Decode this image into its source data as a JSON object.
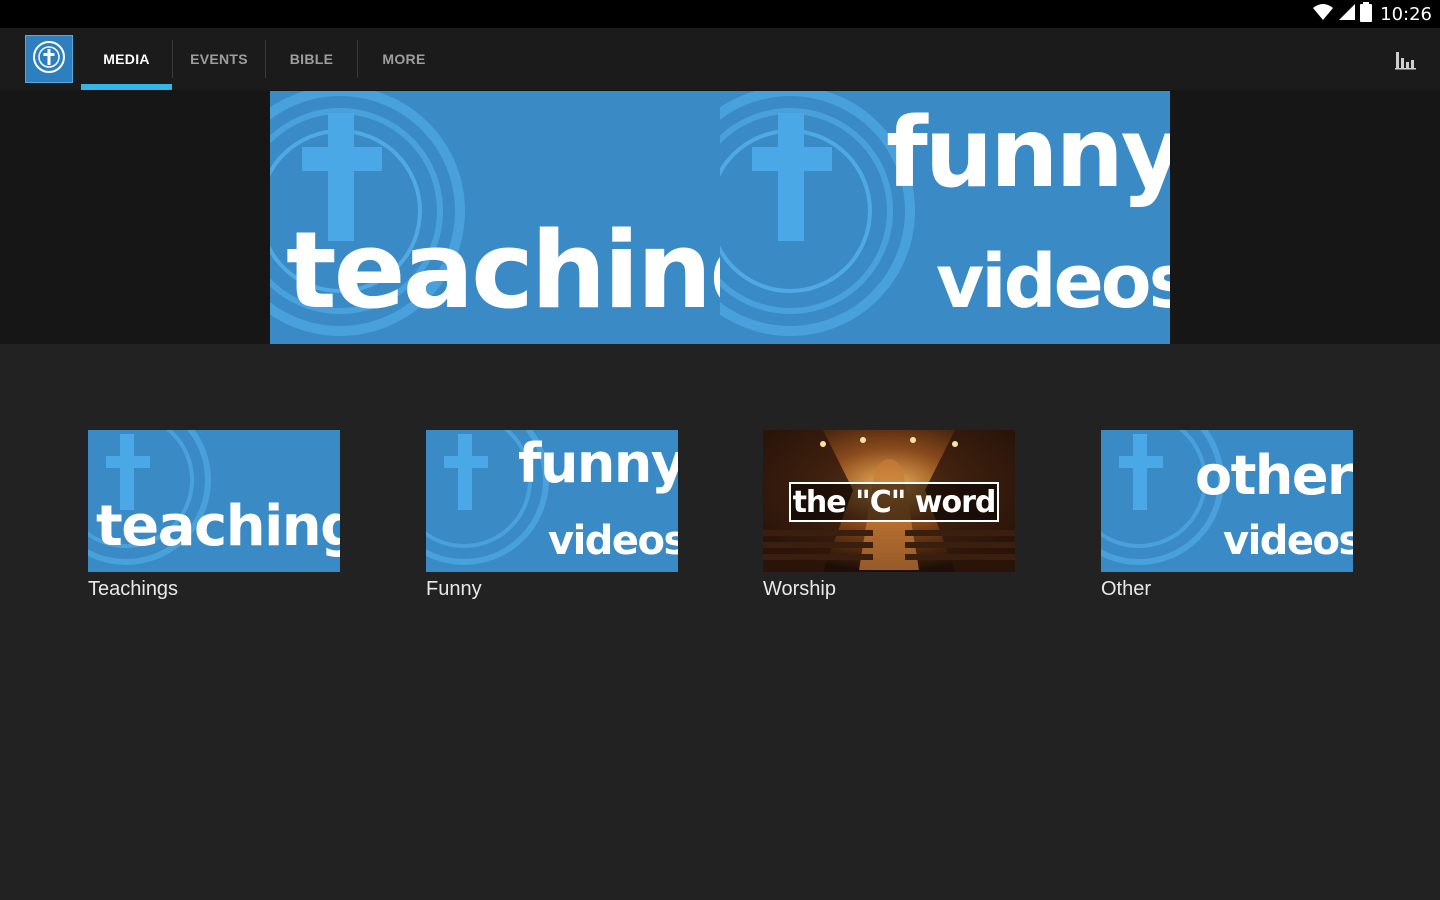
{
  "status_bar": {
    "time": "10:26",
    "icons": [
      "wifi-icon",
      "cellular-signal-icon",
      "battery-icon"
    ]
  },
  "action_bar": {
    "tabs": [
      {
        "label": "MEDIA",
        "active": true
      },
      {
        "label": "EVENTS",
        "active": false
      },
      {
        "label": "BIBLE",
        "active": false
      },
      {
        "label": "MORE",
        "active": false
      }
    ],
    "right_icon": "bar-chart-icon"
  },
  "hero": {
    "panels": [
      {
        "words": [
          "teachings"
        ]
      },
      {
        "words": [
          "funny",
          "videos"
        ]
      }
    ]
  },
  "grid": {
    "tiles": [
      {
        "label": "Teachings",
        "thumb_words": [
          "teachings"
        ]
      },
      {
        "label": "Funny",
        "thumb_words": [
          "funny",
          "videos"
        ]
      },
      {
        "label": "Worship",
        "thumb_caption": "the \"C\" word"
      },
      {
        "label": "Other",
        "thumb_words": [
          "other",
          "videos"
        ]
      }
    ]
  },
  "colors": {
    "accent": "#33b5e5",
    "thumb_blue": "#3a8ac6",
    "background": "#222222"
  }
}
